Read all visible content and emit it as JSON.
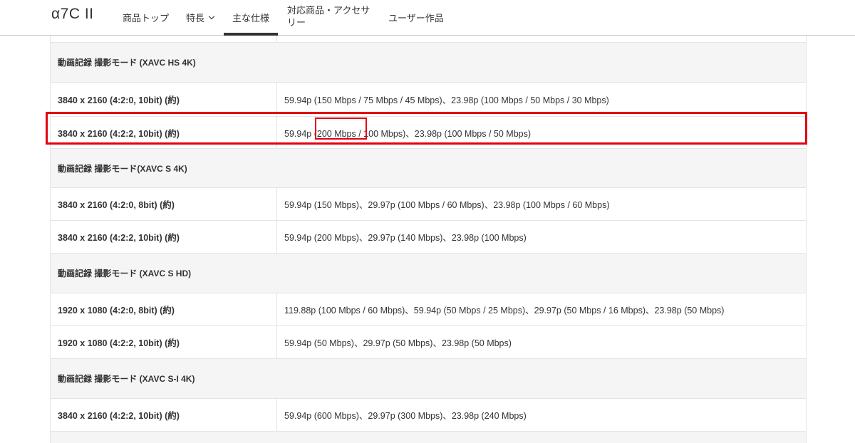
{
  "header": {
    "brand": "α7C II",
    "nav": [
      {
        "label": "商品トップ"
      },
      {
        "label": "特長"
      },
      {
        "label": "主な仕様"
      },
      {
        "label": "対応商品・アクセサリー"
      },
      {
        "label": "ユーザー作品"
      }
    ],
    "active_nav": "主な仕様"
  },
  "spec": {
    "sections": [
      {
        "title": "動画記録 撮影モード (XAVC HS 4K)",
        "rows": [
          {
            "key": "3840 x 2160 (4:2:0, 10bit) (約)",
            "value": "59.94p (150 Mbps / 75 Mbps / 45 Mbps)、23.98p (100 Mbps / 50 Mbps / 30 Mbps)"
          },
          {
            "key": "3840 x 2160 (4:2:2, 10bit) (約)",
            "value": "59.94p (200 Mbps / 100 Mbps)、23.98p (100 Mbps / 50 Mbps)"
          }
        ]
      },
      {
        "title": "動画記録 撮影モード(XAVC S 4K)",
        "rows": [
          {
            "key": "3840 x 2160 (4:2:0, 8bit) (約)",
            "value": "59.94p (150 Mbps)、29.97p (100 Mbps / 60 Mbps)、23.98p (100 Mbps / 60 Mbps)"
          },
          {
            "key": "3840 x 2160 (4:2:2, 10bit) (約)",
            "value": "59.94p (200 Mbps)、29.97p (140 Mbps)、23.98p (100 Mbps)"
          }
        ]
      },
      {
        "title": "動画記録 撮影モード (XAVC S HD)",
        "rows": [
          {
            "key": "1920 x 1080 (4:2:0, 8bit) (約)",
            "value": "119.88p (100 Mbps / 60 Mbps)、59.94p (50 Mbps / 25 Mbps)、29.97p (50 Mbps / 16 Mbps)、23.98p (50 Mbps)"
          },
          {
            "key": "1920 x 1080 (4:2:2, 10bit) (約)",
            "value": "59.94p (50 Mbps)、29.97p (50 Mbps)、23.98p (50 Mbps)"
          }
        ]
      },
      {
        "title": "動画記録 撮影モード (XAVC S-I 4K)",
        "rows": [
          {
            "key": "3840 x 2160 (4:2:2, 10bit) (約)",
            "value": "59.94p (600 Mbps)、29.97p (300 Mbps)、23.98p (240 Mbps)"
          }
        ]
      }
    ]
  },
  "annotation": {
    "highlight_color": "#e3000f",
    "highlighted_row": "3840 x 2160 (4:2:2, 10bit) (約) — XAVC HS 4K",
    "highlighted_text": "200 Mbps"
  }
}
